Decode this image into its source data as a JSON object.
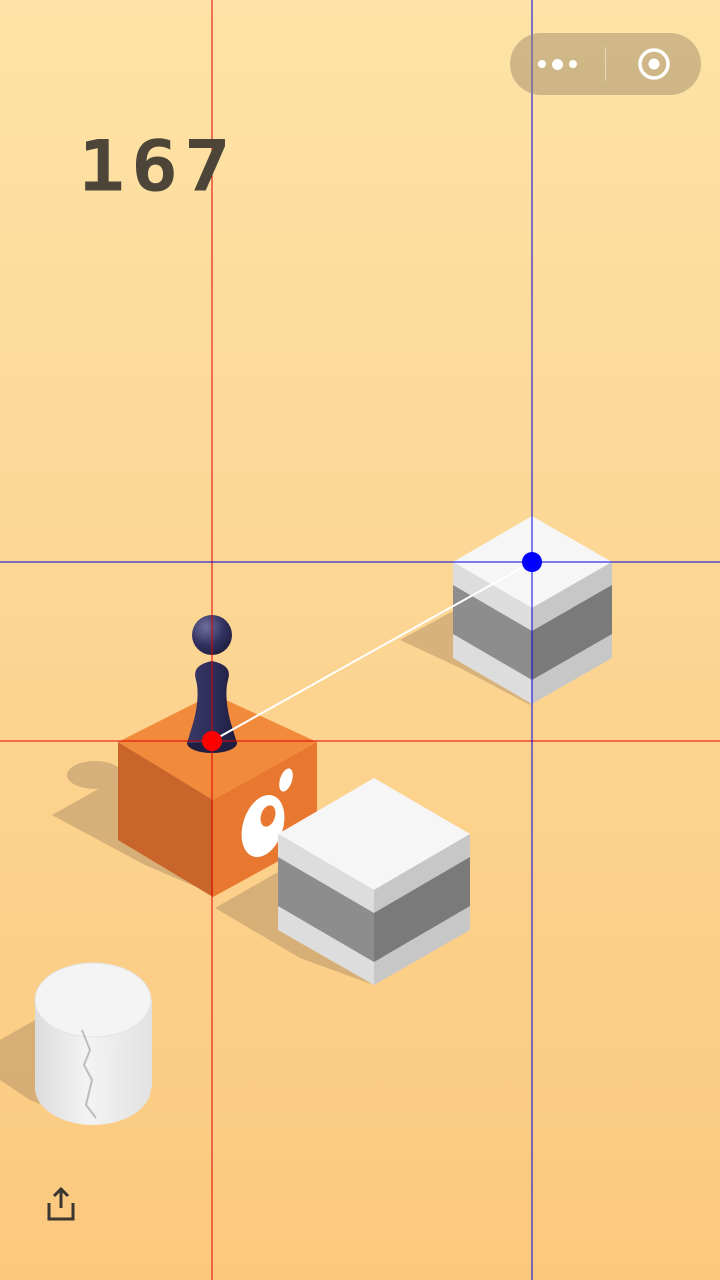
{
  "game": {
    "score": "167"
  },
  "capsule": {
    "more_icon": "more-dots-icon",
    "close_icon": "target-close-icon"
  },
  "toolbar": {
    "share_icon": "share-upload-icon"
  },
  "colors": {
    "background_top": "#fde3a7",
    "background_bottom": "#fbc97e",
    "orange_block": "#f28a3c",
    "white_block": "#f4f4f4",
    "player": "#2f2e5a",
    "score_text": "#4d4638",
    "start_marker": "#ff0000",
    "target_marker": "#0000ff"
  }
}
